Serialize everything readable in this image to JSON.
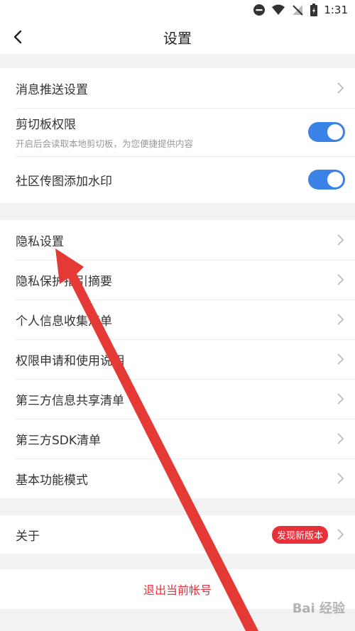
{
  "status": {
    "time": "1:31"
  },
  "nav": {
    "title": "设置"
  },
  "group1": {
    "push": {
      "label": "消息推送设置"
    },
    "clipboard": {
      "label": "剪切板权限",
      "desc": "开启后会读取本地剪切板，为您便捷提供内容",
      "on": true
    },
    "watermark": {
      "label": "社区传图添加水印",
      "on": true
    }
  },
  "group2": {
    "items": [
      {
        "label": "隐私设置"
      },
      {
        "label": "隐私保护指引摘要"
      },
      {
        "label": "个人信息收集清单"
      },
      {
        "label": "权限申请和使用说明"
      },
      {
        "label": "第三方信息共享清单"
      },
      {
        "label": "第三方SDK清单"
      },
      {
        "label": "基本功能模式"
      }
    ]
  },
  "group3": {
    "about": {
      "label": "关于",
      "badge": "发现新版本"
    }
  },
  "logout": {
    "label": "退出当前帐号"
  },
  "watermark_text": "Bai 经验",
  "colors": {
    "accent": "#3b82e6",
    "danger": "#e8303a",
    "arrow": "#e53935"
  }
}
